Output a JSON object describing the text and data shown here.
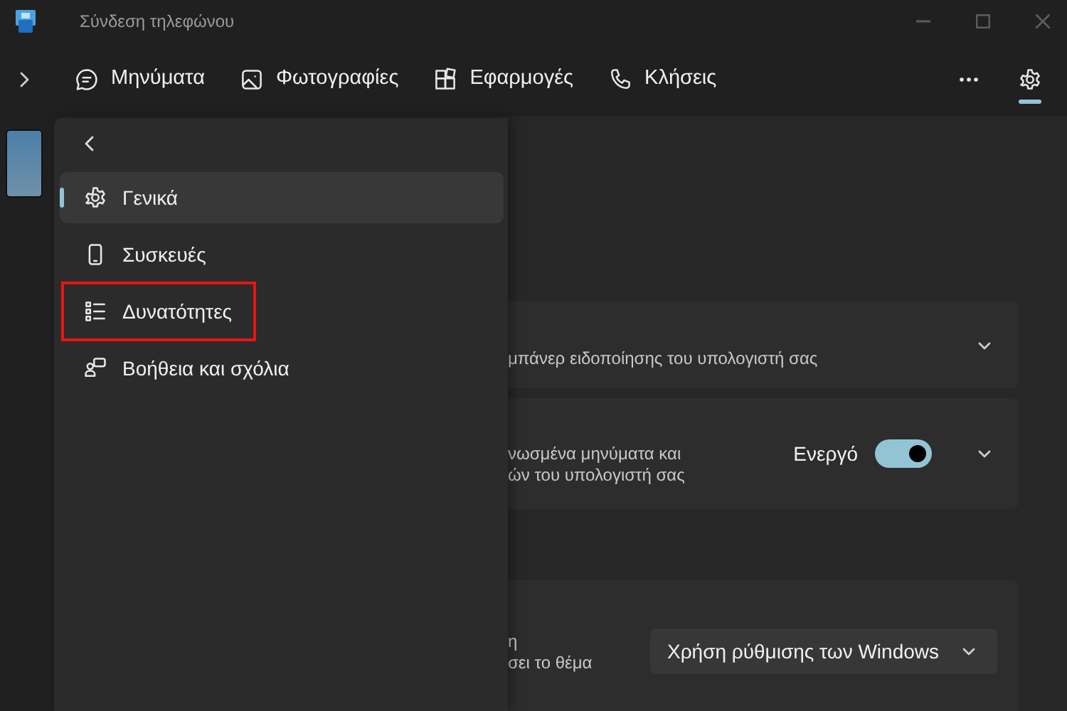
{
  "window": {
    "title": "Σύνδεση τηλεφώνου"
  },
  "nav_tabs": [
    {
      "label": "Μηνύματα",
      "kind": "messages"
    },
    {
      "label": "Φωτογραφίες",
      "kind": "photos"
    },
    {
      "label": "Εφαρμογές",
      "kind": "apps"
    },
    {
      "label": "Κλήσεις",
      "kind": "calls"
    }
  ],
  "settings_selected": true,
  "settings_menu": {
    "items": [
      {
        "label": "Γενικά",
        "kind": "general",
        "selected": true,
        "highlighted": false
      },
      {
        "label": "Συσκευές",
        "kind": "devices",
        "selected": false,
        "highlighted": false
      },
      {
        "label": "Δυνατότητες",
        "kind": "features",
        "selected": false,
        "highlighted": true
      },
      {
        "label": "Βοήθεια και σχόλια",
        "kind": "help",
        "selected": false,
        "highlighted": false
      }
    ]
  },
  "cards": [
    {
      "kind": "expander",
      "description_lines": [
        "μπάνερ ειδοποίησης του υπολογιστή σας"
      ]
    },
    {
      "kind": "toggle",
      "description_lines": [
        "νωσμένα μηνύματα και",
        "ών του υπολογιστή σας"
      ],
      "toggle": {
        "label": "Ενεργό",
        "on": true
      }
    },
    {
      "kind": "dropdown",
      "description_lines": [
        "η",
        "σει το θέμα"
      ],
      "dropdown": {
        "value": "Χρήση ρύθμισης των Windows"
      }
    }
  ]
}
